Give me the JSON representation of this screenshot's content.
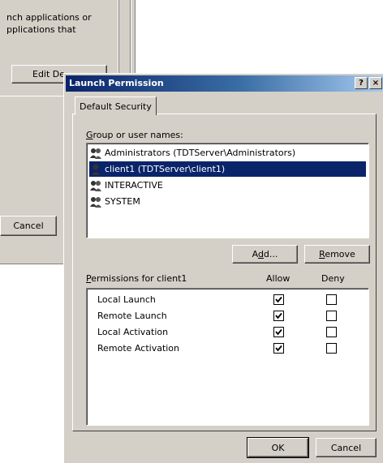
{
  "background_dialog": {
    "text": "nch applications or\npplications that",
    "edit_button_label": "Edit De",
    "cancel_button_label": "Cancel"
  },
  "dialog": {
    "title": "Launch Permission",
    "help_glyph": "?",
    "close_glyph": "×",
    "tab_label": "Default Security",
    "group_label": "Group or user names:",
    "users": [
      {
        "name": "Administrators (TDTServer\\Administrators)",
        "icon": "group-icon",
        "selected": false
      },
      {
        "name": "client1 (TDTServer\\client1)",
        "icon": "user-icon",
        "selected": true
      },
      {
        "name": "INTERACTIVE",
        "icon": "group-icon",
        "selected": false
      },
      {
        "name": "SYSTEM",
        "icon": "group-icon",
        "selected": false
      }
    ],
    "add_button_label": "Add...",
    "remove_button_label": "Remove",
    "permissions_label": "Permissions for client1",
    "allow_header": "Allow",
    "deny_header": "Deny",
    "permissions": [
      {
        "name": "Local Launch",
        "allow": true,
        "deny": false
      },
      {
        "name": "Remote Launch",
        "allow": true,
        "deny": false
      },
      {
        "name": "Local Activation",
        "allow": true,
        "deny": false
      },
      {
        "name": "Remote Activation",
        "allow": true,
        "deny": false
      }
    ],
    "ok_button_label": "OK",
    "cancel_button_label": "Cancel"
  },
  "colors": {
    "dialog_face": "#d4d0c8",
    "title_start": "#0a246a",
    "title_end": "#a6caf0",
    "selection": "#0a246a"
  }
}
